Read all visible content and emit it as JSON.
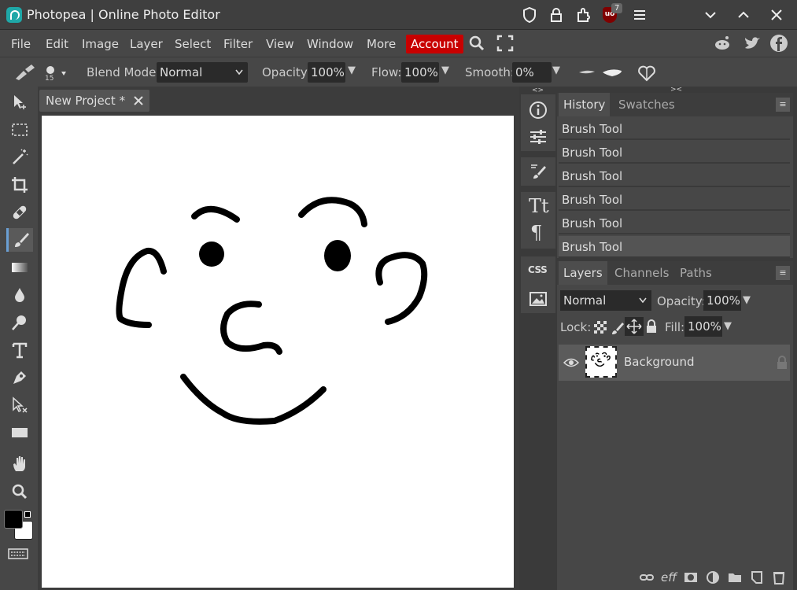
{
  "window": {
    "title": "Photopea | Online Photo Editor",
    "extension_badge_count": "7"
  },
  "menu": {
    "items": [
      "File",
      "Edit",
      "Image",
      "Layer",
      "Select",
      "Filter",
      "View",
      "Window",
      "More"
    ],
    "account_label": "Account"
  },
  "options": {
    "brush_size": "15",
    "blend_mode_label": "Blend Mode:",
    "blend_mode_value": "Normal",
    "opacity_label": "Opacity:",
    "opacity_value": "100%",
    "flow_label": "Flow:",
    "flow_value": "100%",
    "smooth_label": "Smooth:",
    "smooth_value": "0%"
  },
  "document": {
    "tab_label": "New Project *"
  },
  "history_panel": {
    "tabs": [
      "History",
      "Swatches"
    ],
    "items": [
      "Brush Tool",
      "Brush Tool",
      "Brush Tool",
      "Brush Tool",
      "Brush Tool",
      "Brush Tool"
    ]
  },
  "layers_panel": {
    "tabs": [
      "Layers",
      "Channels",
      "Paths"
    ],
    "blend_mode": "Normal",
    "opacity_label": "Opacity:",
    "opacity_value": "100%",
    "lock_label": "Lock:",
    "fill_label": "Fill:",
    "fill_value": "100%",
    "layers": [
      {
        "name": "Background",
        "visible": true,
        "locked": true
      }
    ],
    "bottom_effects_label": "eff"
  },
  "colors": {
    "accent_account": "#c80000",
    "foreground": "#000000",
    "background": "#ffffff"
  }
}
